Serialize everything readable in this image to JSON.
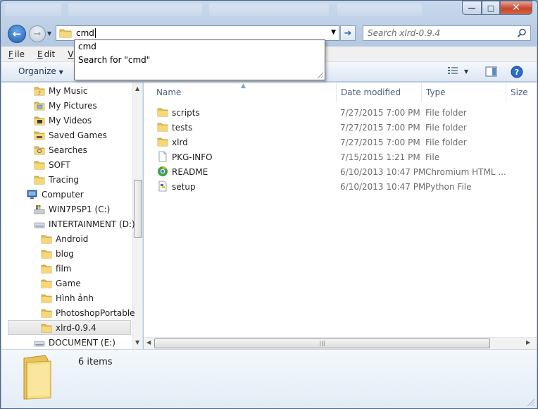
{
  "window": {
    "minimize_glyph": "—",
    "maximize_glyph": "□",
    "close_glyph": "✕"
  },
  "address": {
    "value": "cmd"
  },
  "search": {
    "placeholder": "Search xlrd-0.9.4"
  },
  "autocomplete": {
    "items": [
      "cmd",
      "Search for \"cmd\""
    ]
  },
  "menu": {
    "items": [
      {
        "accel": "F",
        "rest": "ile"
      },
      {
        "accel": "E",
        "rest": "dit"
      },
      {
        "accel": "V",
        "rest": "ie"
      }
    ]
  },
  "toolbar": {
    "organize_label": "Organize"
  },
  "nav": {
    "items": [
      {
        "label": "My Music",
        "icon": "music-folder-icon"
      },
      {
        "label": "My Pictures",
        "icon": "pictures-folder-icon"
      },
      {
        "label": "My Videos",
        "icon": "videos-folder-icon"
      },
      {
        "label": "Saved Games",
        "icon": "saved-games-icon"
      },
      {
        "label": "Searches",
        "icon": "searches-icon"
      },
      {
        "label": "SOFT",
        "icon": "folder-icon"
      },
      {
        "label": "Tracing",
        "icon": "folder-icon"
      },
      {
        "label": "Computer",
        "icon": "computer-icon"
      },
      {
        "label": "WIN7PSP1 (C:)",
        "icon": "windows-drive-icon"
      },
      {
        "label": "INTERTAINMENT (D:)",
        "icon": "drive-icon"
      },
      {
        "label": "Android",
        "icon": "folder-icon"
      },
      {
        "label": "blog",
        "icon": "folder-icon"
      },
      {
        "label": "film",
        "icon": "folder-icon"
      },
      {
        "label": "Game",
        "icon": "folder-icon"
      },
      {
        "label": "Hình ảnh",
        "icon": "folder-icon"
      },
      {
        "label": "PhotoshopPortable",
        "icon": "folder-icon"
      },
      {
        "label": "xlrd-0.9.4",
        "icon": "folder-icon"
      },
      {
        "label": "DOCUMENT (E:)",
        "icon": "drive-icon"
      }
    ]
  },
  "columns": {
    "name": "Name",
    "date": "Date modified",
    "type": "Type",
    "size": "Size"
  },
  "files": [
    {
      "name": "scripts",
      "date": "7/27/2015 7:00 PM",
      "type": "File folder",
      "icon": "folder-icon"
    },
    {
      "name": "tests",
      "date": "7/27/2015 7:00 PM",
      "type": "File folder",
      "icon": "folder-icon"
    },
    {
      "name": "xlrd",
      "date": "7/27/2015 7:00 PM",
      "type": "File folder",
      "icon": "folder-icon"
    },
    {
      "name": "PKG-INFO",
      "date": "7/15/2015 1:21 PM",
      "type": "File",
      "icon": "file-icon"
    },
    {
      "name": "README",
      "date": "6/10/2013 10:47 PM",
      "type": "Chromium HTML ...",
      "icon": "chromium-html-icon"
    },
    {
      "name": "setup",
      "date": "6/10/2013 10:47 PM",
      "type": "Python File",
      "icon": "python-file-icon"
    }
  ],
  "status": {
    "item_count": "6 items"
  }
}
